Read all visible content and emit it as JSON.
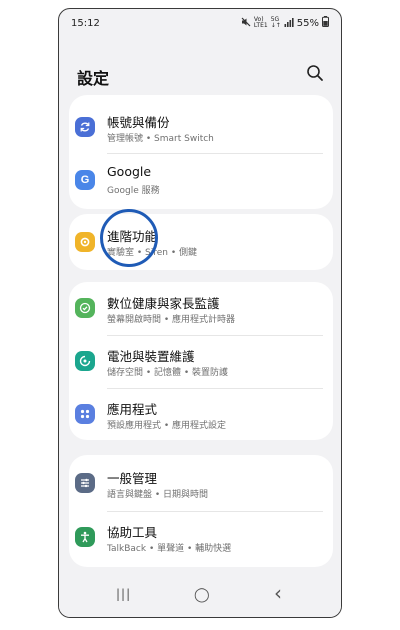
{
  "statusbar": {
    "time": "15:12",
    "volte_top": "Vo)",
    "volte_bottom": "LTE1",
    "signal_top": "5G",
    "signal_bottom": "↓↑",
    "battery": "55%"
  },
  "header": {
    "title": "設定"
  },
  "cards": [
    {
      "items": [
        {
          "label": "帳號與備份",
          "sub": "管理帳號 • Smart Switch",
          "icon": "sync-icon",
          "color": "#4a6fd6"
        },
        {
          "label": "Google",
          "sub": "Google 服務",
          "icon": "google-icon",
          "color": "#4a86e8"
        }
      ]
    },
    {
      "items": [
        {
          "label": "進階功能",
          "sub": "實驗室 • Siren • 側鍵",
          "icon": "gear-plus-icon",
          "color": "#f0b429"
        }
      ]
    },
    {
      "items": [
        {
          "label": "數位健康與家長監護",
          "sub": "螢幕開啟時間 • 應用程式計時器",
          "icon": "wellbeing-icon",
          "color": "#54b45c"
        },
        {
          "label": "電池與裝置維護",
          "sub": "儲存空間 • 記憶體 • 裝置防護",
          "icon": "device-care-icon",
          "color": "#1ba68e"
        },
        {
          "label": "應用程式",
          "sub": "預設應用程式 • 應用程式設定",
          "icon": "apps-icon",
          "color": "#5a7fe0"
        }
      ]
    },
    {
      "items": [
        {
          "label": "一般管理",
          "sub": "語言與鍵盤 • 日期與時間",
          "icon": "sliders-icon",
          "color": "#5b6b86"
        },
        {
          "label": "協助工具",
          "sub": "TalkBack • 單聲道 • 輔助快選",
          "icon": "accessibility-icon",
          "color": "#2f9a5a"
        }
      ]
    }
  ],
  "navbar": {
    "recent": "|||",
    "home": "◯",
    "back": "‹"
  }
}
